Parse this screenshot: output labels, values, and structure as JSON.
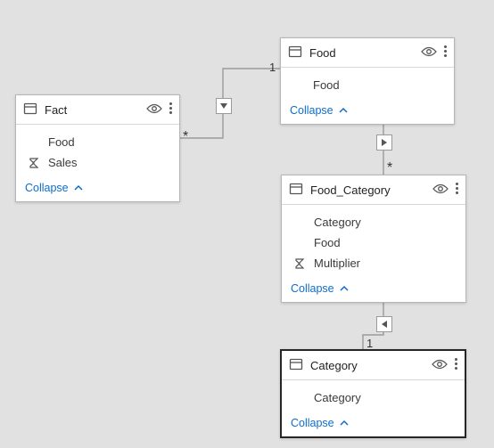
{
  "collapse_label": "Collapse",
  "tables": {
    "fact": {
      "name": "Fact",
      "fields": [
        "Food",
        "Sales"
      ],
      "measure_flags": [
        false,
        true
      ]
    },
    "food": {
      "name": "Food",
      "fields": [
        "Food"
      ],
      "measure_flags": [
        false
      ]
    },
    "food_category": {
      "name": "Food_Category",
      "fields": [
        "Category",
        "Food",
        "Multiplier"
      ],
      "measure_flags": [
        false,
        false,
        true
      ]
    },
    "category": {
      "name": "Category",
      "fields": [
        "Category"
      ],
      "measure_flags": [
        false
      ]
    }
  },
  "relationships": [
    {
      "from": "food",
      "to": "fact",
      "from_card": "1",
      "to_card": "*",
      "direction": "single"
    },
    {
      "from": "food",
      "to": "food_category",
      "from_card": "1",
      "to_card": "*",
      "direction": "single"
    },
    {
      "from": "category",
      "to": "food_category",
      "from_card": "1",
      "to_card": "*",
      "direction": "single"
    }
  ]
}
